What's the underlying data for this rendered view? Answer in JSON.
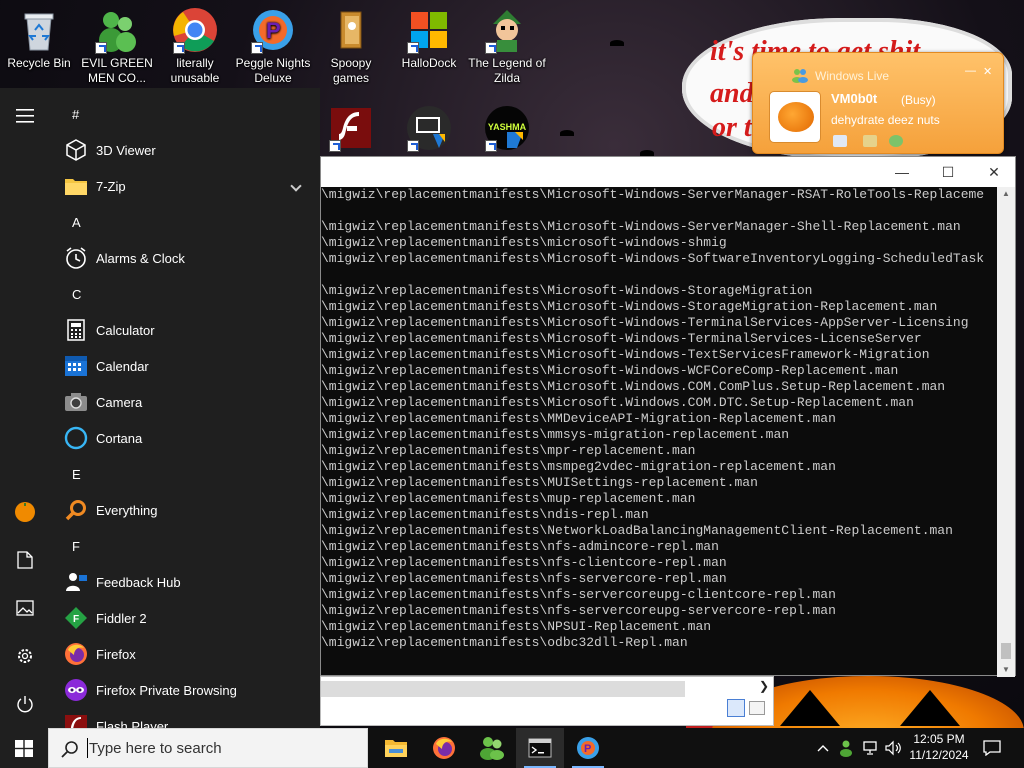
{
  "desktop": {
    "icons": [
      {
        "label": "Recycle Bin"
      },
      {
        "label": "EVIL GREEN MEN CO..."
      },
      {
        "label": "literally unusable"
      },
      {
        "label": "Peggle Nights Deluxe"
      },
      {
        "label": "Spoopy games"
      },
      {
        "label": "HalloDock"
      },
      {
        "label": "The Legend of Zilda"
      }
    ],
    "second_row": [
      {
        "icon": "flash-icon"
      },
      {
        "icon": "display-settings-icon"
      },
      {
        "icon": "yashma-icon",
        "text": "YASHMA"
      }
    ],
    "wallpaper_text": [
      "it's time to get shit",
      "and",
      "or t"
    ]
  },
  "messenger": {
    "title": "Windows Live",
    "name": "VM0b0t",
    "status": "(Busy)",
    "personal_message": "dehydrate deez nuts"
  },
  "console": {
    "lines": [
      "\\migwiz\\replacementmanifests\\Microsoft-Windows-ServerManager-RSAT-RoleTools-Replaceme",
      "",
      "\\migwiz\\replacementmanifests\\Microsoft-Windows-ServerManager-Shell-Replacement.man",
      "\\migwiz\\replacementmanifests\\microsoft-windows-shmig",
      "\\migwiz\\replacementmanifests\\Microsoft-Windows-SoftwareInventoryLogging-ScheduledTask",
      "",
      "\\migwiz\\replacementmanifests\\Microsoft-Windows-StorageMigration",
      "\\migwiz\\replacementmanifests\\Microsoft-Windows-StorageMigration-Replacement.man",
      "\\migwiz\\replacementmanifests\\Microsoft-Windows-TerminalServices-AppServer-Licensing",
      "\\migwiz\\replacementmanifests\\Microsoft-Windows-TerminalServices-LicenseServer",
      "\\migwiz\\replacementmanifests\\Microsoft-Windows-TextServicesFramework-Migration",
      "\\migwiz\\replacementmanifests\\Microsoft-Windows-WCFCoreComp-Replacement.man",
      "\\migwiz\\replacementmanifests\\Microsoft.Windows.COM.ComPlus.Setup-Replacement.man",
      "\\migwiz\\replacementmanifests\\Microsoft.Windows.COM.DTC.Setup-Replacement.man",
      "\\migwiz\\replacementmanifests\\MMDeviceAPI-Migration-Replacement.man",
      "\\migwiz\\replacementmanifests\\mmsys-migration-replacement.man",
      "\\migwiz\\replacementmanifests\\mpr-replacement.man",
      "\\migwiz\\replacementmanifests\\msmpeg2vdec-migration-replacement.man",
      "\\migwiz\\replacementmanifests\\MUISettings-replacement.man",
      "\\migwiz\\replacementmanifests\\mup-replacement.man",
      "\\migwiz\\replacementmanifests\\ndis-repl.man",
      "\\migwiz\\replacementmanifests\\NetworkLoadBalancingManagementClient-Replacement.man",
      "\\migwiz\\replacementmanifests\\nfs-admincore-repl.man",
      "\\migwiz\\replacementmanifests\\nfs-clientcore-repl.man",
      "\\migwiz\\replacementmanifests\\nfs-servercore-repl.man",
      "\\migwiz\\replacementmanifests\\nfs-servercoreupg-clientcore-repl.man",
      "\\migwiz\\replacementmanifests\\nfs-servercoreupg-servercore-repl.man",
      "\\migwiz\\replacementmanifests\\NPSUI-Replacement.man",
      "\\migwiz\\replacementmanifests\\odbc32dll-Repl.man"
    ]
  },
  "start_menu": {
    "rows": [
      {
        "type": "letter",
        "text": "#"
      },
      {
        "type": "app",
        "text": "3D Viewer",
        "icon": "cube-icon"
      },
      {
        "type": "folder",
        "text": "7-Zip",
        "icon": "folder-icon"
      },
      {
        "type": "letter",
        "text": "A"
      },
      {
        "type": "app",
        "text": "Alarms & Clock",
        "icon": "alarm-clock-icon"
      },
      {
        "type": "letter",
        "text": "C"
      },
      {
        "type": "app",
        "text": "Calculator",
        "icon": "calculator-icon"
      },
      {
        "type": "app",
        "text": "Calendar",
        "icon": "calendar-icon"
      },
      {
        "type": "app",
        "text": "Camera",
        "icon": "camera-icon"
      },
      {
        "type": "app",
        "text": "Cortana",
        "icon": "cortana-icon"
      },
      {
        "type": "letter",
        "text": "E"
      },
      {
        "type": "app",
        "text": "Everything",
        "icon": "magnifier-icon"
      },
      {
        "type": "letter",
        "text": "F"
      },
      {
        "type": "app",
        "text": "Feedback Hub",
        "icon": "feedback-hub-icon"
      },
      {
        "type": "app",
        "text": "Fiddler 2",
        "icon": "fiddler-icon"
      },
      {
        "type": "app",
        "text": "Firefox",
        "icon": "firefox-icon"
      },
      {
        "type": "app",
        "text": "Firefox Private Browsing",
        "icon": "firefox-private-icon"
      },
      {
        "type": "app",
        "text": "Flash Player",
        "icon": "flash-player-icon"
      }
    ]
  },
  "taskbar": {
    "search_placeholder": "Type here to search",
    "pinned": [
      "file-explorer-icon",
      "firefox-icon",
      "messenger-icon",
      "cmd-icon",
      "peggle-icon"
    ],
    "time": "12:05 PM",
    "date": "11/12/2024"
  }
}
